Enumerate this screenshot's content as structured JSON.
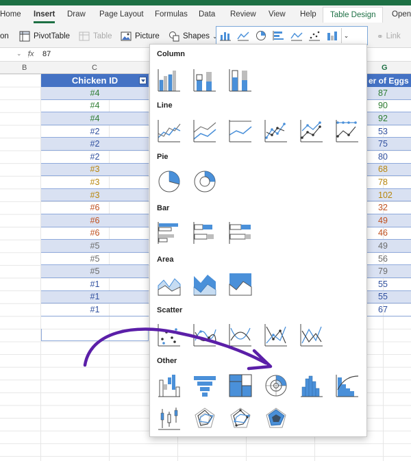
{
  "tabs": [
    "Home",
    "Insert",
    "Draw",
    "Page Layout",
    "Formulas",
    "Data",
    "Review",
    "View",
    "Help",
    "Table Design",
    "Open"
  ],
  "ribbon": {
    "on_label": "on",
    "pivot_label": "PivotTable",
    "table_label": "Table",
    "picture_label": "Picture",
    "shapes_label": "Shapes",
    "link_label": "Link"
  },
  "formula": {
    "cell_ref": "",
    "fx": "fx",
    "value": "87"
  },
  "columns": [
    "B",
    "C",
    "G"
  ],
  "table": {
    "header_c": "Chicken ID",
    "header_g": "er of Eggs L",
    "ids": [
      "#4",
      "#4",
      "#4",
      "#2",
      "#2",
      "#2",
      "#3",
      "#3",
      "#3",
      "#6",
      "#6",
      "#6",
      "#5",
      "#5",
      "#5",
      "#1",
      "#1",
      "#1"
    ],
    "eggs": [
      "87",
      "90",
      "92",
      "53",
      "75",
      "80",
      "68",
      "78",
      "102",
      "32",
      "49",
      "46",
      "49",
      "56",
      "79",
      "55",
      "55",
      "67"
    ],
    "colors": [
      "#2e7d32",
      "#2e7d32",
      "#2e7d32",
      "#2f4f9e",
      "#2f4f9e",
      "#2f4f9e",
      "#b8860b",
      "#b8860b",
      "#b8860b",
      "#c0501e",
      "#c0501e",
      "#c0501e",
      "#6b6b6b",
      "#6b6b6b",
      "#6b6b6b",
      "#2f4f9e",
      "#2f4f9e",
      "#2f4f9e"
    ]
  },
  "panel": {
    "sections": {
      "column": "Column",
      "line": "Line",
      "pie": "Pie",
      "bar": "Bar",
      "area": "Area",
      "scatter": "Scatter",
      "other": "Other"
    }
  },
  "accent": {
    "excel_green": "#1d7044",
    "table_blue": "#4472c4",
    "annotation_purple": "#5b1fa8"
  }
}
